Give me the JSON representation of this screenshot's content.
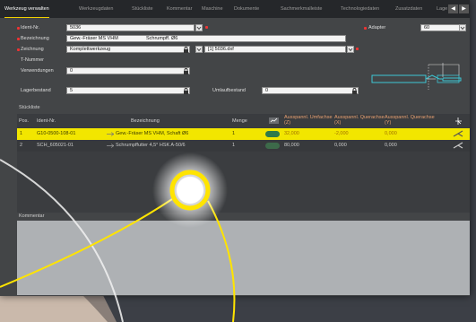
{
  "tabs": [
    {
      "label": "Werkzeug verwalten",
      "active": true
    },
    {
      "label": "Werkzeugdaten",
      "active": false
    },
    {
      "label": "Stückliste",
      "active": false
    },
    {
      "label": "Kommentar",
      "active": false
    },
    {
      "label": "Maschine",
      "active": false
    },
    {
      "label": "Dokumente",
      "active": false
    },
    {
      "label": "Sachmerkmalleiste",
      "active": false
    },
    {
      "label": "Technologiedaten",
      "active": false
    },
    {
      "label": "Zusatzdaten",
      "active": false
    },
    {
      "label": "Lage",
      "active": false
    }
  ],
  "nav": {
    "prev": "◀",
    "next": "▶"
  },
  "form": {
    "ident_label": "Ident-Nr.",
    "ident_value": "5036",
    "bezeichnung_label": "Bezeichnung",
    "bezeichnung_value1": "Gew.-Fräser MS VHM",
    "bezeichnung_value2": "Schrumpff. Ø6",
    "zeichnung_label": "Zeichnung",
    "zeichnung_value": "Komplettwerkzeug",
    "zeichnung_file": "[1] 5036.dxf",
    "tnummer_label": "T-Nummer",
    "verwendungen_label": "Verwendungen",
    "verwendungen_value": "0",
    "lagerbestand_label": "Lagerbestand",
    "lagerbestand_value": "5",
    "umlaufbestand_label": "Umlaufbestand",
    "umlaufbestand_value": "0",
    "adapter_label": "Adapter",
    "adapter_value": "60"
  },
  "stueckliste": {
    "title": "Stückliste",
    "headers": {
      "pos": "Pos.",
      "ident": "Ident-Nr.",
      "bezeichnung": "Bezeichnung",
      "menge": "Menge",
      "ausspannl": "Ausspannl. Umfachse (Z)",
      "ausspannl_x": "Ausspannl. Querachse (X)",
      "ausspannl_y": "Ausspannl. Querachse (Y)"
    },
    "rows": [
      {
        "pos": "1",
        "ident": "G10-0500-108-01",
        "bezeichnung": "Gew.-Fräser MS VHM, Schaft Ø6",
        "menge": "1",
        "z": "32,000",
        "x": "-2,000",
        "y": "0,000"
      },
      {
        "pos": "2",
        "ident": "SCH_605021-01",
        "bezeichnung": "Schrumpffutter 4,5° HSK A-50/6",
        "menge": "1",
        "z": "80,000",
        "x": "0,000",
        "y": "0,000"
      }
    ]
  },
  "kommentar": {
    "title": "Kommentar"
  },
  "colors": {
    "highlight": "#f2e600",
    "accent_yellow": "#ffe400",
    "required": "#e33333",
    "diagram_cyan": "#3cc6d4",
    "pill_green": "#2e7a4a"
  }
}
